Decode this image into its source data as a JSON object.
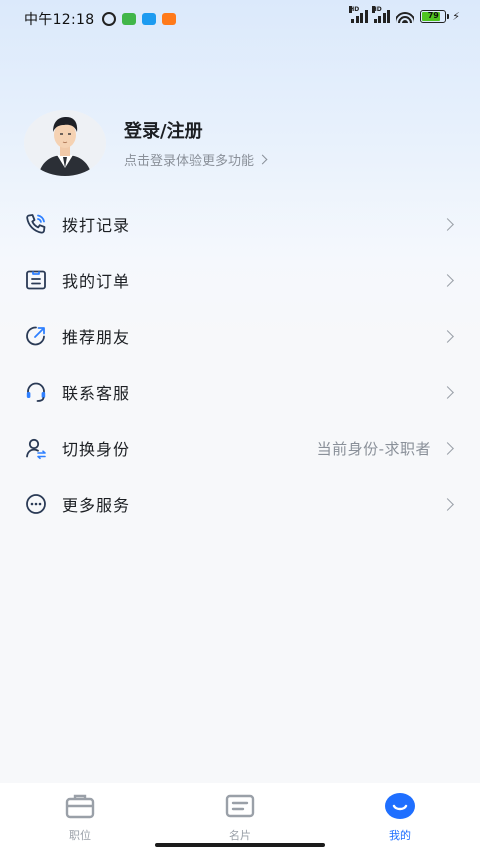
{
  "status_bar": {
    "time": "中午12:18",
    "battery_level": "79",
    "signal_1_label": "HD",
    "signal_2_label": "HD",
    "notification_icons": [
      "alarm-icon",
      "green-app-icon",
      "blue-app-icon",
      "mi-app-icon"
    ]
  },
  "profile": {
    "title": "登录/注册",
    "subtitle": "点击登录体验更多功能"
  },
  "menu": {
    "items": [
      {
        "label": "拨打记录",
        "icon": "phone-call-icon"
      },
      {
        "label": "我的订单",
        "icon": "order-icon"
      },
      {
        "label": "推荐朋友",
        "icon": "share-icon"
      },
      {
        "label": "联系客服",
        "icon": "headset-icon"
      },
      {
        "label": "切换身份",
        "icon": "switch-user-icon",
        "value": "当前身份-求职者"
      },
      {
        "label": "更多服务",
        "icon": "more-icon"
      }
    ]
  },
  "tabbar": {
    "tabs": [
      {
        "label": "职位",
        "icon": "briefcase-icon",
        "active": false
      },
      {
        "label": "名片",
        "icon": "card-icon",
        "active": false
      },
      {
        "label": "我的",
        "icon": "smile-icon",
        "active": true
      }
    ]
  },
  "colors": {
    "accent": "#1f6fff",
    "icon_stroke": "#2a3a55",
    "icon_accent": "#2f80ff",
    "muted_text": "#8a9099"
  }
}
